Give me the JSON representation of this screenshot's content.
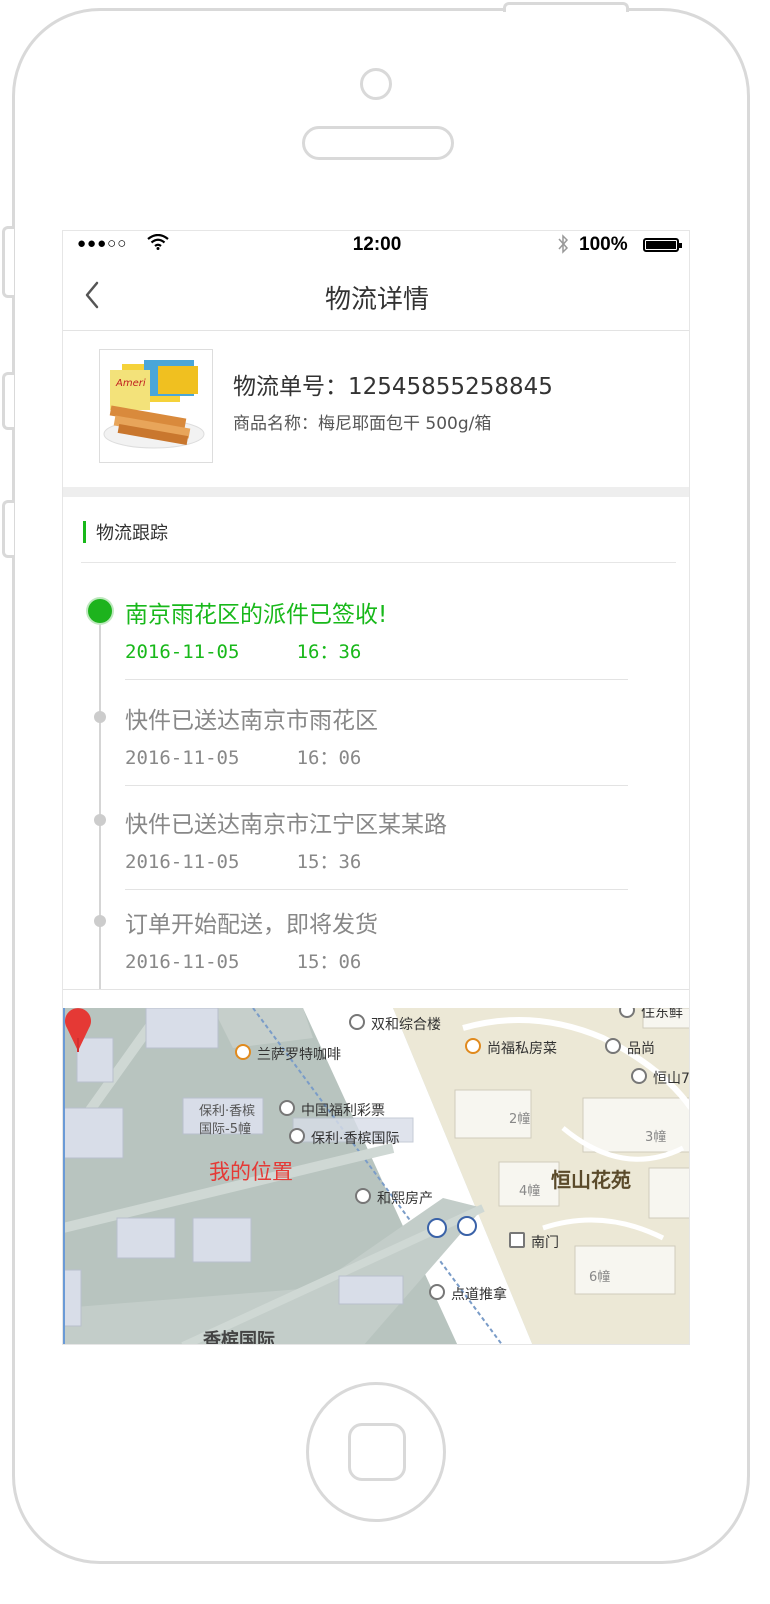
{
  "status_bar": {
    "signal": "●●●○○",
    "time": "12:00",
    "battery_pct": "100%"
  },
  "nav": {
    "title": "物流详情"
  },
  "product": {
    "order_no": "物流单号：12545855258845",
    "product_name": "商品名称：梅尼耶面包干  500g/箱"
  },
  "tracking": {
    "section_title": "物流跟踪",
    "events": [
      {
        "title": "南京雨花区的派件已签收!",
        "date": "2016-11-05",
        "time": "16：36",
        "active": true
      },
      {
        "title": "快件已送达南京市雨花区",
        "date": "2016-11-05",
        "time": "16：06",
        "active": false
      },
      {
        "title": "快件已送达南京市江宁区某某路",
        "date": "2016-11-05",
        "time": "15：36",
        "active": false
      },
      {
        "title": "订单开始配送，即将发货",
        "date": "2016-11-05",
        "time": "15：06",
        "active": false
      }
    ]
  },
  "map": {
    "my_location": "我的位置",
    "labels": {
      "l1": "双和综合楼",
      "l2": "兰萨罗特咖啡",
      "l3": "尚福私房菜",
      "l4": "品尚",
      "l5": "恒山7",
      "l6": "中国福利彩票",
      "l7": "保利·香槟",
      "l8": "国际-5幢",
      "l9": "保利·香槟国际",
      "l10": "和熙房产",
      "l11": "恒山花苑",
      "l12": "南门",
      "l13": "点道推拿",
      "l14": "香槟国际",
      "l15": "住东鲜",
      "b2": "2幢",
      "b3": "3幢",
      "b4": "4幢",
      "b6": "6幢"
    },
    "colors": {
      "left_area": "#b8c4bf",
      "right_area": "#ece8d6",
      "road": "#ffffff",
      "pin": "#e53935"
    }
  },
  "colors": {
    "accent_green": "#18b81a",
    "muted_text": "#888888"
  }
}
